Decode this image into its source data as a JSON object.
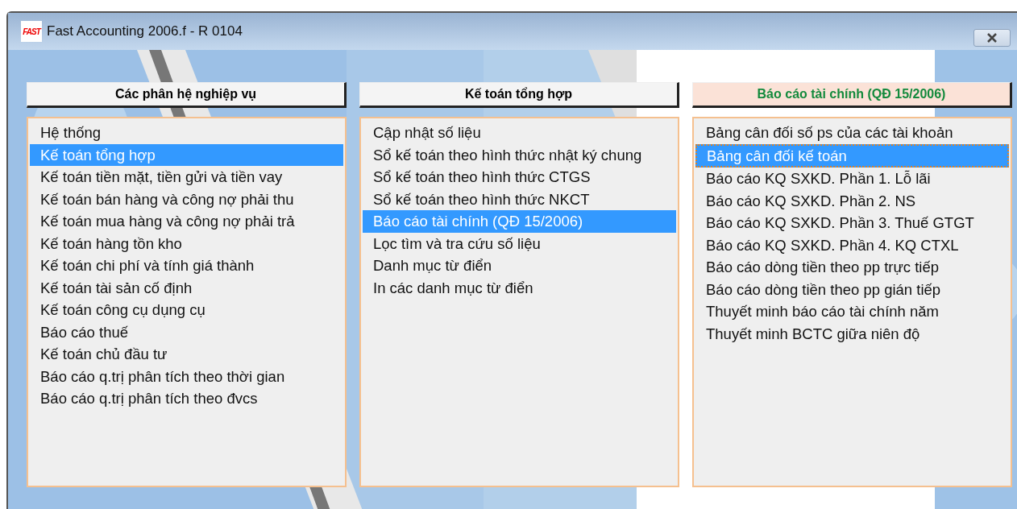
{
  "window": {
    "title": "Fast Accounting 2006.f - R 0104",
    "logo_text": "FAST"
  },
  "columns": [
    {
      "header": "Các phân hệ nghiệp vụ",
      "selected": false,
      "focused": false,
      "items": [
        {
          "label": "Hệ thống",
          "selected": false
        },
        {
          "label": "Kế toán tổng hợp",
          "selected": true
        },
        {
          "label": "Kế toán tiền mặt, tiền gửi và tiền vay",
          "selected": false
        },
        {
          "label": "Kế toán bán hàng và công nợ phải thu",
          "selected": false
        },
        {
          "label": "Kế toán mua hàng và công nợ phải trả",
          "selected": false
        },
        {
          "label": "Kế toán hàng tồn kho",
          "selected": false
        },
        {
          "label": "Kế toán chi phí và tính giá thành",
          "selected": false
        },
        {
          "label": "Kế toán tài sản cố định",
          "selected": false
        },
        {
          "label": "Kế toán công cụ dụng cụ",
          "selected": false
        },
        {
          "label": "Báo cáo thuế",
          "selected": false
        },
        {
          "label": "Kế toán chủ đầu tư",
          "selected": false
        },
        {
          "label": "Báo cáo q.trị phân tích theo thời gian",
          "selected": false
        },
        {
          "label": "Báo cáo q.trị phân tích theo đvcs",
          "selected": false
        }
      ]
    },
    {
      "header": "Kế toán tổng hợp",
      "selected": false,
      "focused": false,
      "items": [
        {
          "label": "Cập nhật số liệu",
          "selected": false
        },
        {
          "label": "Sổ kế toán theo hình thức nhật ký chung",
          "selected": false
        },
        {
          "label": "Sổ kế toán theo hình thức CTGS",
          "selected": false
        },
        {
          "label": "Sổ kế toán theo hình thức NKCT",
          "selected": false
        },
        {
          "label": "Báo cáo tài chính (QĐ 15/2006)",
          "selected": true
        },
        {
          "label": "Lọc tìm và tra cứu số liệu",
          "selected": false
        },
        {
          "label": "Danh mục từ điển",
          "selected": false
        },
        {
          "label": "In các danh mục từ điển",
          "selected": false
        }
      ]
    },
    {
      "header": "Báo cáo tài chính (QĐ 15/2006)",
      "selected": true,
      "focused": true,
      "items": [
        {
          "label": "Bảng cân đối số ps của các tài khoản",
          "selected": false
        },
        {
          "label": "Bảng cân đối kế toán",
          "selected": true
        },
        {
          "label": "Báo cáo KQ SXKD. Phần 1. Lỗ lãi",
          "selected": false
        },
        {
          "label": "Báo cáo KQ SXKD. Phần 2. NS",
          "selected": false
        },
        {
          "label": "Báo cáo KQ SXKD. Phần 3. Thuế GTGT",
          "selected": false
        },
        {
          "label": "Báo cáo KQ SXKD. Phần 4. KQ CTXL",
          "selected": false
        },
        {
          "label": "Báo cáo dòng tiền theo pp trực tiếp",
          "selected": false
        },
        {
          "label": "Báo cáo dòng tiền theo pp gián tiếp",
          "selected": false
        },
        {
          "label": "Thuyết minh báo cáo tài chính năm",
          "selected": false
        },
        {
          "label": "Thuyết minh BCTC giữa niên độ",
          "selected": false
        }
      ]
    }
  ]
}
